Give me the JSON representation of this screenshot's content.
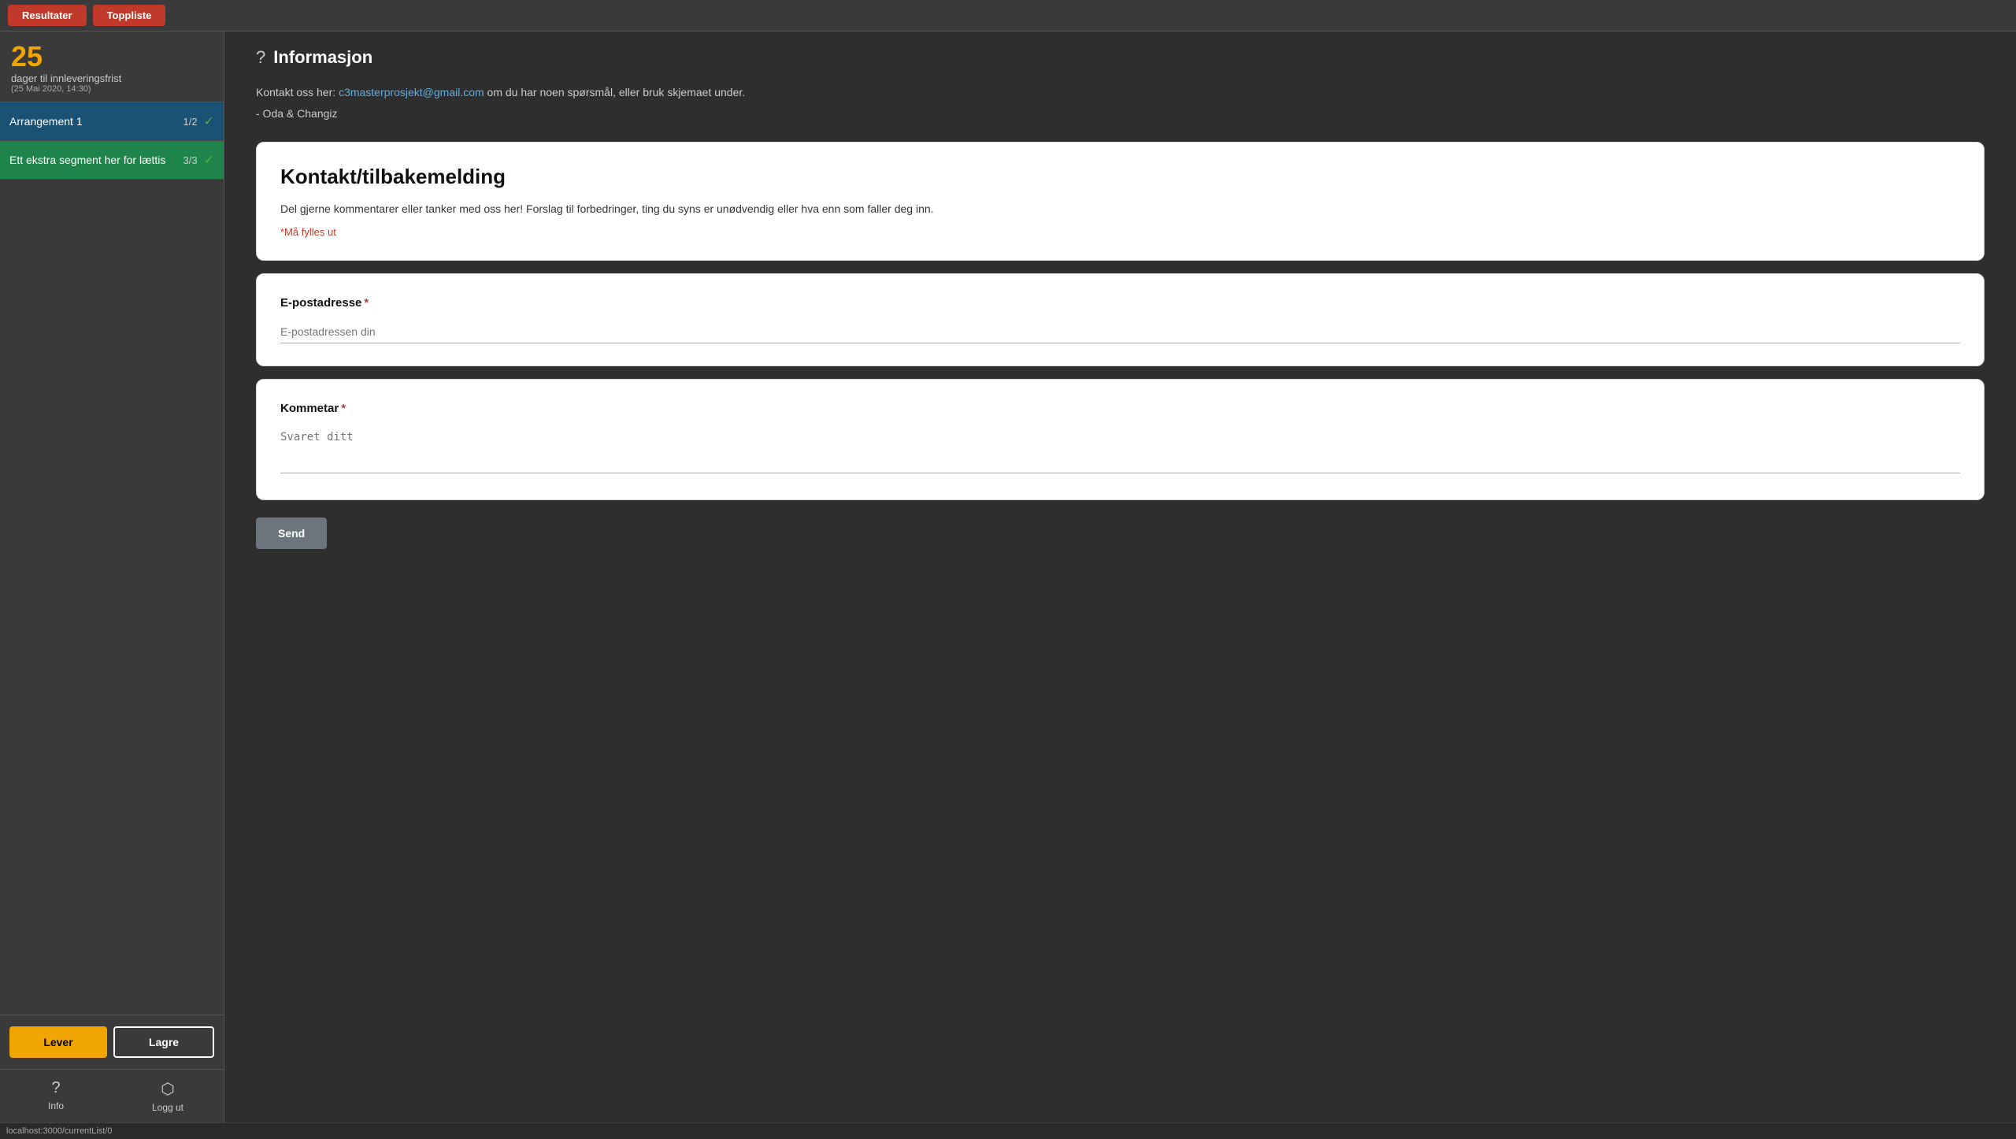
{
  "topbar": {
    "btn_resultater": "Resultater",
    "btn_toppliste": "Toppliste"
  },
  "sidebar": {
    "deadline_number": "25",
    "deadline_label": "dager til innleveringsfrist",
    "deadline_date": "(25 Mai 2020, 14:30)",
    "segments": [
      {
        "label": "Arrangement 1",
        "progress": "1/2",
        "checked": true,
        "bg": "blue"
      },
      {
        "label": "Ett ekstra segment her for lættis",
        "progress": "3/3",
        "checked": true,
        "bg": "green"
      }
    ],
    "btn_lever": "Lever",
    "btn_lagre": "Lagre",
    "nav_info": "Info",
    "nav_logg_ut": "Logg ut"
  },
  "main": {
    "page_title": "Informasjon",
    "intro_text_before": "Kontakt oss her: ",
    "intro_email": "c3masterprosjekt@gmail.com",
    "intro_text_after": " om du har noen spørsmål, eller bruk skjemaet under.",
    "intro_signature": "- Oda & Changiz",
    "contact_card": {
      "title": "Kontakt/tilbakemelding",
      "description": "Del gjerne kommentarer eller tanker med oss her! Forslag til forbedringer, ting du syns er unødvendig eller hva enn som faller deg inn.",
      "required_note": "*Må fylles ut"
    },
    "email_card": {
      "label": "E-postadresse",
      "placeholder": "E-postadressen din"
    },
    "comment_card": {
      "label": "Kommetar",
      "placeholder": "Svaret ditt"
    },
    "btn_send": "Send"
  },
  "statusbar": {
    "url": "localhost:3000/currentList/0"
  }
}
